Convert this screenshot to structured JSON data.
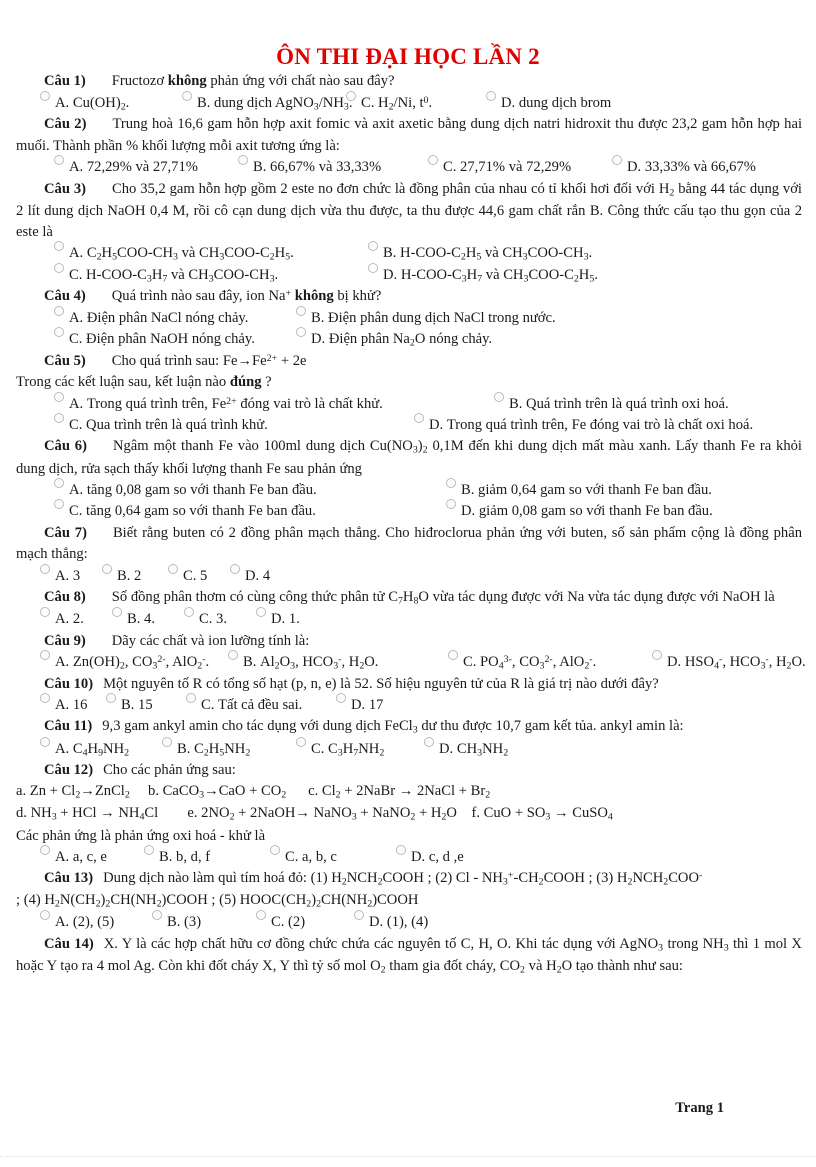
{
  "document": {
    "title": "ÔN THI ĐẠI HỌC LẦN 2",
    "title_color": "#e00000",
    "footer": "Trang 1"
  },
  "questions": [
    {
      "num": "Câu 1)",
      "stem_html": "Fructozơ <b>không</b> phản ứng với chất nào sau đây?",
      "options": [
        {
          "label": "A.",
          "html": "Cu(OH)<sub>2</sub>."
        },
        {
          "label": "B.",
          "html": "dung dịch AgNO<sub>3</sub>/NH<sub>3</sub>."
        },
        {
          "label": "C.",
          "html": "H<sub>2</sub>/Ni, t<sup>0</sup>."
        },
        {
          "label": "D.",
          "html": "dung dịch brom"
        }
      ]
    },
    {
      "num": "Câu 2)",
      "stem_html": "Trung hoà 16,6 gam hỗn hợp axit fomic và axit axetic bằng dung dịch natri hidroxit thu được 23,2 gam hỗn hợp hai muối. Thành phần % khối lượng mỗi axit tương ứng là:",
      "options": [
        {
          "label": "A.",
          "html": "72,29% và 27,71%"
        },
        {
          "label": "B.",
          "html": "66,67% và 33,33%"
        },
        {
          "label": "C.",
          "html": "27,71% và 72,29%"
        },
        {
          "label": "D.",
          "html": "33,33% và 66,67%"
        }
      ]
    },
    {
      "num": "Câu 3)",
      "stem_html": "Cho 35,2 gam hỗn hợp gồm 2 este no đơn chức là đồng phân của nhau có tỉ khối hơi đối với H<sub>2</sub> bằng 44 tác dụng với 2 lít dung dịch NaOH 0,4 M, rồi cô cạn dung dịch vừa thu được, ta thu được 44,6 gam chất rắn B. Công thức cấu tạo thu gọn của 2 este là",
      "options": [
        {
          "label": "A.",
          "html": "C<sub>2</sub>H<sub>5</sub>COO-CH<sub>3</sub> và CH<sub>3</sub>COO-C<sub>2</sub>H<sub>5</sub>."
        },
        {
          "label": "B.",
          "html": "H-COO-C<sub>2</sub>H<sub>5</sub> và CH<sub>3</sub>COO-CH<sub>3</sub>."
        },
        {
          "label": "C.",
          "html": "H-COO-C<sub>3</sub>H<sub>7</sub> và CH<sub>3</sub>COO-CH<sub>3</sub>."
        },
        {
          "label": "D.",
          "html": "H-COO-C<sub>3</sub>H<sub>7</sub> và CH<sub>3</sub>COO-C<sub>2</sub>H<sub>5</sub>."
        }
      ]
    },
    {
      "num": "Câu 4)",
      "stem_html": "Quá trình nào sau đây, ion Na<sup>+</sup> <b>không</b> bị khử?",
      "options": [
        {
          "label": "A.",
          "html": "Điện phân NaCl nóng chảy."
        },
        {
          "label": "B.",
          "html": "Điện phân dung dịch NaCl trong nước."
        },
        {
          "label": "C.",
          "html": "Điện phân NaOH nóng chảy."
        },
        {
          "label": "D.",
          "html": "Điện phân Na<sub>2</sub>O nóng chảy."
        }
      ]
    },
    {
      "num": "Câu 5)",
      "stem_html": "Cho quá trình sau: Fe&#8594;Fe<sup>2+</sup> + 2e",
      "stem_line2_html": "Trong các kết luận sau, kết luận nào <b>đúng</b> ?",
      "options": [
        {
          "label": "A.",
          "html": "Trong quá trình trên, Fe<sup>2+</sup> đóng vai trò là chất khử."
        },
        {
          "label": "B.",
          "html": "Quá trình trên là quá trình oxi hoá."
        },
        {
          "label": "C.",
          "html": "Qua trình trên là quá trình khử."
        },
        {
          "label": "D.",
          "html": "Trong quá trình trên, Fe đóng vai trò là chất oxi hoá."
        }
      ]
    },
    {
      "num": "Câu 6)",
      "stem_html": "Ngâm một thanh Fe vào 100ml dung dịch Cu(NO<sub>3</sub>)<sub>2</sub> 0,1M đến khi dung dịch mất màu xanh. Lấy thanh Fe ra khỏi dung dịch, rửa sạch thấy khối lượng thanh Fe sau phản ứng",
      "options": [
        {
          "label": "A.",
          "html": "tăng 0,08 gam so với thanh Fe ban đầu."
        },
        {
          "label": "B.",
          "html": "giảm 0,64 gam so với thanh Fe ban đầu."
        },
        {
          "label": "C.",
          "html": "tăng 0,64 gam so với thanh Fe ban đầu."
        },
        {
          "label": "D.",
          "html": "giảm 0,08 gam so với thanh Fe ban đầu."
        }
      ]
    },
    {
      "num": "Câu 7)",
      "stem_html": "Biết rằng buten có 2 đồng phân mạch thẳng. Cho hiđroclorua phản ứng với buten, số sản phẩm cộng là đồng phân mạch thẳng:",
      "options": [
        {
          "label": "A.",
          "html": "3"
        },
        {
          "label": "B.",
          "html": "2"
        },
        {
          "label": "C.",
          "html": "5"
        },
        {
          "label": "D.",
          "html": "4"
        }
      ]
    },
    {
      "num": "Câu 8)",
      "stem_html": "Số đồng phân thơm có cùng công thức phân tử C<sub>7</sub>H<sub>8</sub>O vừa tác dụng được với Na vừa tác dụng được với NaOH là",
      "options": [
        {
          "label": "A.",
          "html": "2."
        },
        {
          "label": "B.",
          "html": "4."
        },
        {
          "label": "C.",
          "html": "3."
        },
        {
          "label": "D.",
          "html": "1."
        }
      ]
    },
    {
      "num": "Câu 9)",
      "stem_html": "Dãy các chất và ion lưỡng tính là:",
      "options": [
        {
          "label": "A.",
          "html": "Zn(OH)<sub>2</sub>, CO<sub>3</sub><sup>2-</sup>, AlO<sub>2</sub><sup>-</sup>."
        },
        {
          "label": "B.",
          "html": "Al<sub>2</sub>O<sub>3</sub>, HCO<sub>3</sub><sup>-</sup>, H<sub>2</sub>O."
        },
        {
          "label": "C.",
          "html": "PO<sub>4</sub><sup>3-</sup>, CO<sub>3</sub><sup>2-</sup>, AlO<sub>2</sub><sup>-</sup>."
        },
        {
          "label": "D.",
          "html": "HSO<sub>4</sub><sup>-</sup>, HCO<sub>3</sub><sup>-</sup>, H<sub>2</sub>O."
        }
      ]
    },
    {
      "num": "Câu 10)",
      "stem_html": "Một nguyên tố R có tổng số hạt (p, n, e) là 52. Số hiệu nguyên tử của R là giá trị nào dưới đây?",
      "options": [
        {
          "label": "A.",
          "html": "16"
        },
        {
          "label": "B.",
          "html": "15"
        },
        {
          "label": "C.",
          "html": "Tất cả đều sai."
        },
        {
          "label": "D.",
          "html": "17"
        }
      ]
    },
    {
      "num": "Câu 11)",
      "stem_html": "9,3 gam ankyl amin cho tác dụng với dung dịch FeCl<sub>3</sub> dư thu được 10,7 gam kết tủa. ankyl amin là:",
      "options": [
        {
          "label": "A.",
          "html": "C<sub>4</sub>H<sub>9</sub>NH<sub>2</sub>"
        },
        {
          "label": "B.",
          "html": "C<sub>2</sub>H<sub>5</sub>NH<sub>2</sub>"
        },
        {
          "label": "C.",
          "html": "C<sub>3</sub>H<sub>7</sub>NH<sub>2</sub>"
        },
        {
          "label": "D.",
          "html": "CH<sub>3</sub>NH<sub>2</sub>"
        }
      ]
    },
    {
      "num": "Câu 12)",
      "stem_html": "Cho các phản ứng sau:",
      "reactions_line1": "a. Zn + Cl<sub>2</sub>&#8594;ZnCl<sub>2</sub>&nbsp;&nbsp;&nbsp;&nbsp;&nbsp;b. CaCO<sub>3</sub>&#8594;CaO + CO<sub>2</sub>&nbsp;&nbsp;&nbsp;&nbsp;&nbsp;&nbsp;c. Cl<sub>2</sub> + 2NaBr &#8594; 2NaCl + Br<sub>2</sub>",
      "reactions_line2": "d. NH<sub>3</sub> + HCl &#8594; NH<sub>4</sub>Cl&nbsp;&nbsp;&nbsp;&nbsp;&nbsp;&nbsp;&nbsp;&nbsp;e. 2NO<sub>2</sub> + 2NaOH&#8594; NaNO<sub>3</sub> + NaNO<sub>2</sub> + H<sub>2</sub>O&nbsp;&nbsp;&nbsp;&nbsp;f. CuO + SO<sub>3</sub> &#8594; CuSO<sub>4</sub>",
      "reactions_line3": "Các phản ứng là phản ứng oxi hoá - khử là",
      "options": [
        {
          "label": "A.",
          "html": "a, c, e"
        },
        {
          "label": "B.",
          "html": "b, d, f"
        },
        {
          "label": "C.",
          "html": "a, b, c"
        },
        {
          "label": "D.",
          "html": "c, d ,e"
        }
      ]
    },
    {
      "num": "Câu 13)",
      "stem_html": "Dung dịch nào làm quì tím hoá đỏ: (1) H<sub>2</sub>NCH<sub>2</sub>COOH ; (2) Cl - NH<sub>3</sub><sup>+</sup>-CH<sub>2</sub>COOH ; (3) H<sub>2</sub>NCH<sub>2</sub>COO<sup>-</sup>",
      "stem_line2_html": "; (4) H<sub>2</sub>N(CH<sub>2</sub>)<sub>2</sub>CH(NH<sub>2</sub>)COOH ; (5) HOOC(CH<sub>2</sub>)<sub>2</sub>CH(NH<sub>2</sub>)COOH",
      "options": [
        {
          "label": "A.",
          "html": "(2), (5)"
        },
        {
          "label": "B.",
          "html": "(3)"
        },
        {
          "label": "C.",
          "html": "(2)"
        },
        {
          "label": "D.",
          "html": "(1), (4)"
        }
      ]
    },
    {
      "num": "Câu 14)",
      "stem_html": "X. Y là các hợp chất hữu cơ đồng chức chứa các nguyên tố C, H, O. Khi tác dụng với AgNO<sub>3</sub> trong NH<sub>3</sub> thì 1 mol X hoặc Y tạo ra 4 mol Ag. Còn khi đốt cháy X, Y thì tỷ số mol O<sub>2</sub> tham gia đốt cháy, CO<sub>2</sub> và H<sub>2</sub>O tạo thành như sau:",
      "options": []
    }
  ]
}
